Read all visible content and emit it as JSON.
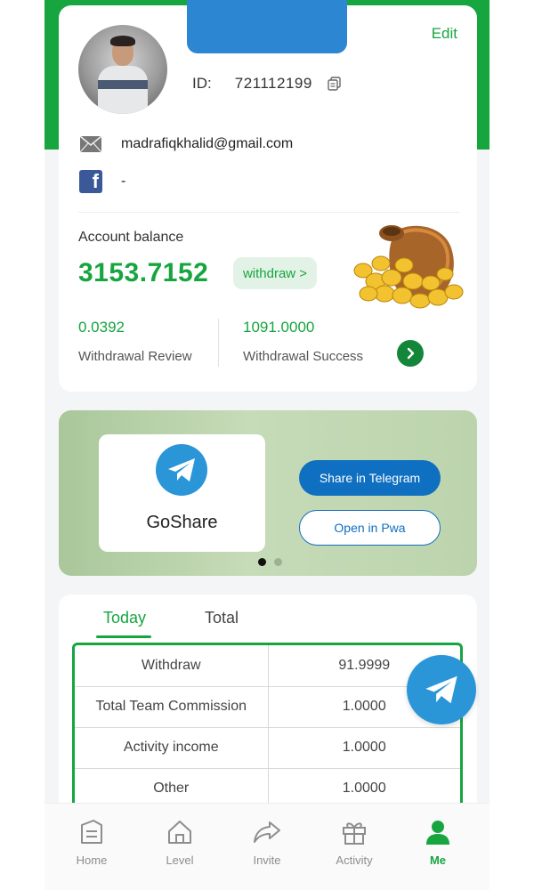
{
  "profile": {
    "edit_label": "Edit",
    "id_label": "ID:",
    "id_value": "721112199",
    "email": "madrafiqkhalid@gmail.com",
    "facebook": "-"
  },
  "balance": {
    "label": "Account balance",
    "value": "3153.7152",
    "withdraw_button": "withdraw >",
    "review_value": "0.0392",
    "review_label": "Withdrawal Review",
    "success_value": "1091.0000",
    "success_label": "Withdrawal Success"
  },
  "banner": {
    "brand": "GoShare",
    "share_button": "Share in Telegram",
    "pwa_button": "Open in Pwa",
    "active_slide": 1,
    "slide_count": 2
  },
  "stats": {
    "tabs": [
      "Today",
      "Total"
    ],
    "active_tab": "Today",
    "rows": [
      {
        "label": "Withdraw",
        "value": "91.9999"
      },
      {
        "label": "Total Team Commission",
        "value": "1.0000"
      },
      {
        "label": "Activity income",
        "value": "1.0000"
      },
      {
        "label": "Other",
        "value": "1.0000"
      }
    ]
  },
  "nav": {
    "items": [
      {
        "label": "Home",
        "icon": "home-icon"
      },
      {
        "label": "Level",
        "icon": "house-level-icon"
      },
      {
        "label": "Invite",
        "icon": "share-arrow-icon"
      },
      {
        "label": "Activity",
        "icon": "gift-icon"
      },
      {
        "label": "Me",
        "icon": "person-icon"
      }
    ],
    "active": "Me"
  },
  "colors": {
    "brand_green": "#17a53f",
    "telegram_blue": "#2a96d8",
    "button_blue": "#0f6fc0",
    "notch_blue": "#2d86d1"
  }
}
